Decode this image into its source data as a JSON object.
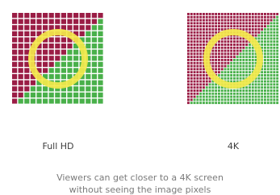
{
  "colors": {
    "red": "#9a1d45",
    "green": "#49b04a",
    "ring": "#f4e94c",
    "gap": "#ffffff"
  },
  "grids": [
    {
      "id": "fullhd",
      "label": "Full HD",
      "cells_per_side": 15
    },
    {
      "id": "4k",
      "label": "4K",
      "cells_per_side": 30
    }
  ],
  "caption": {
    "line1": "Viewers can get closer to a 4K screen",
    "line2": "without seeing the image pixels"
  }
}
